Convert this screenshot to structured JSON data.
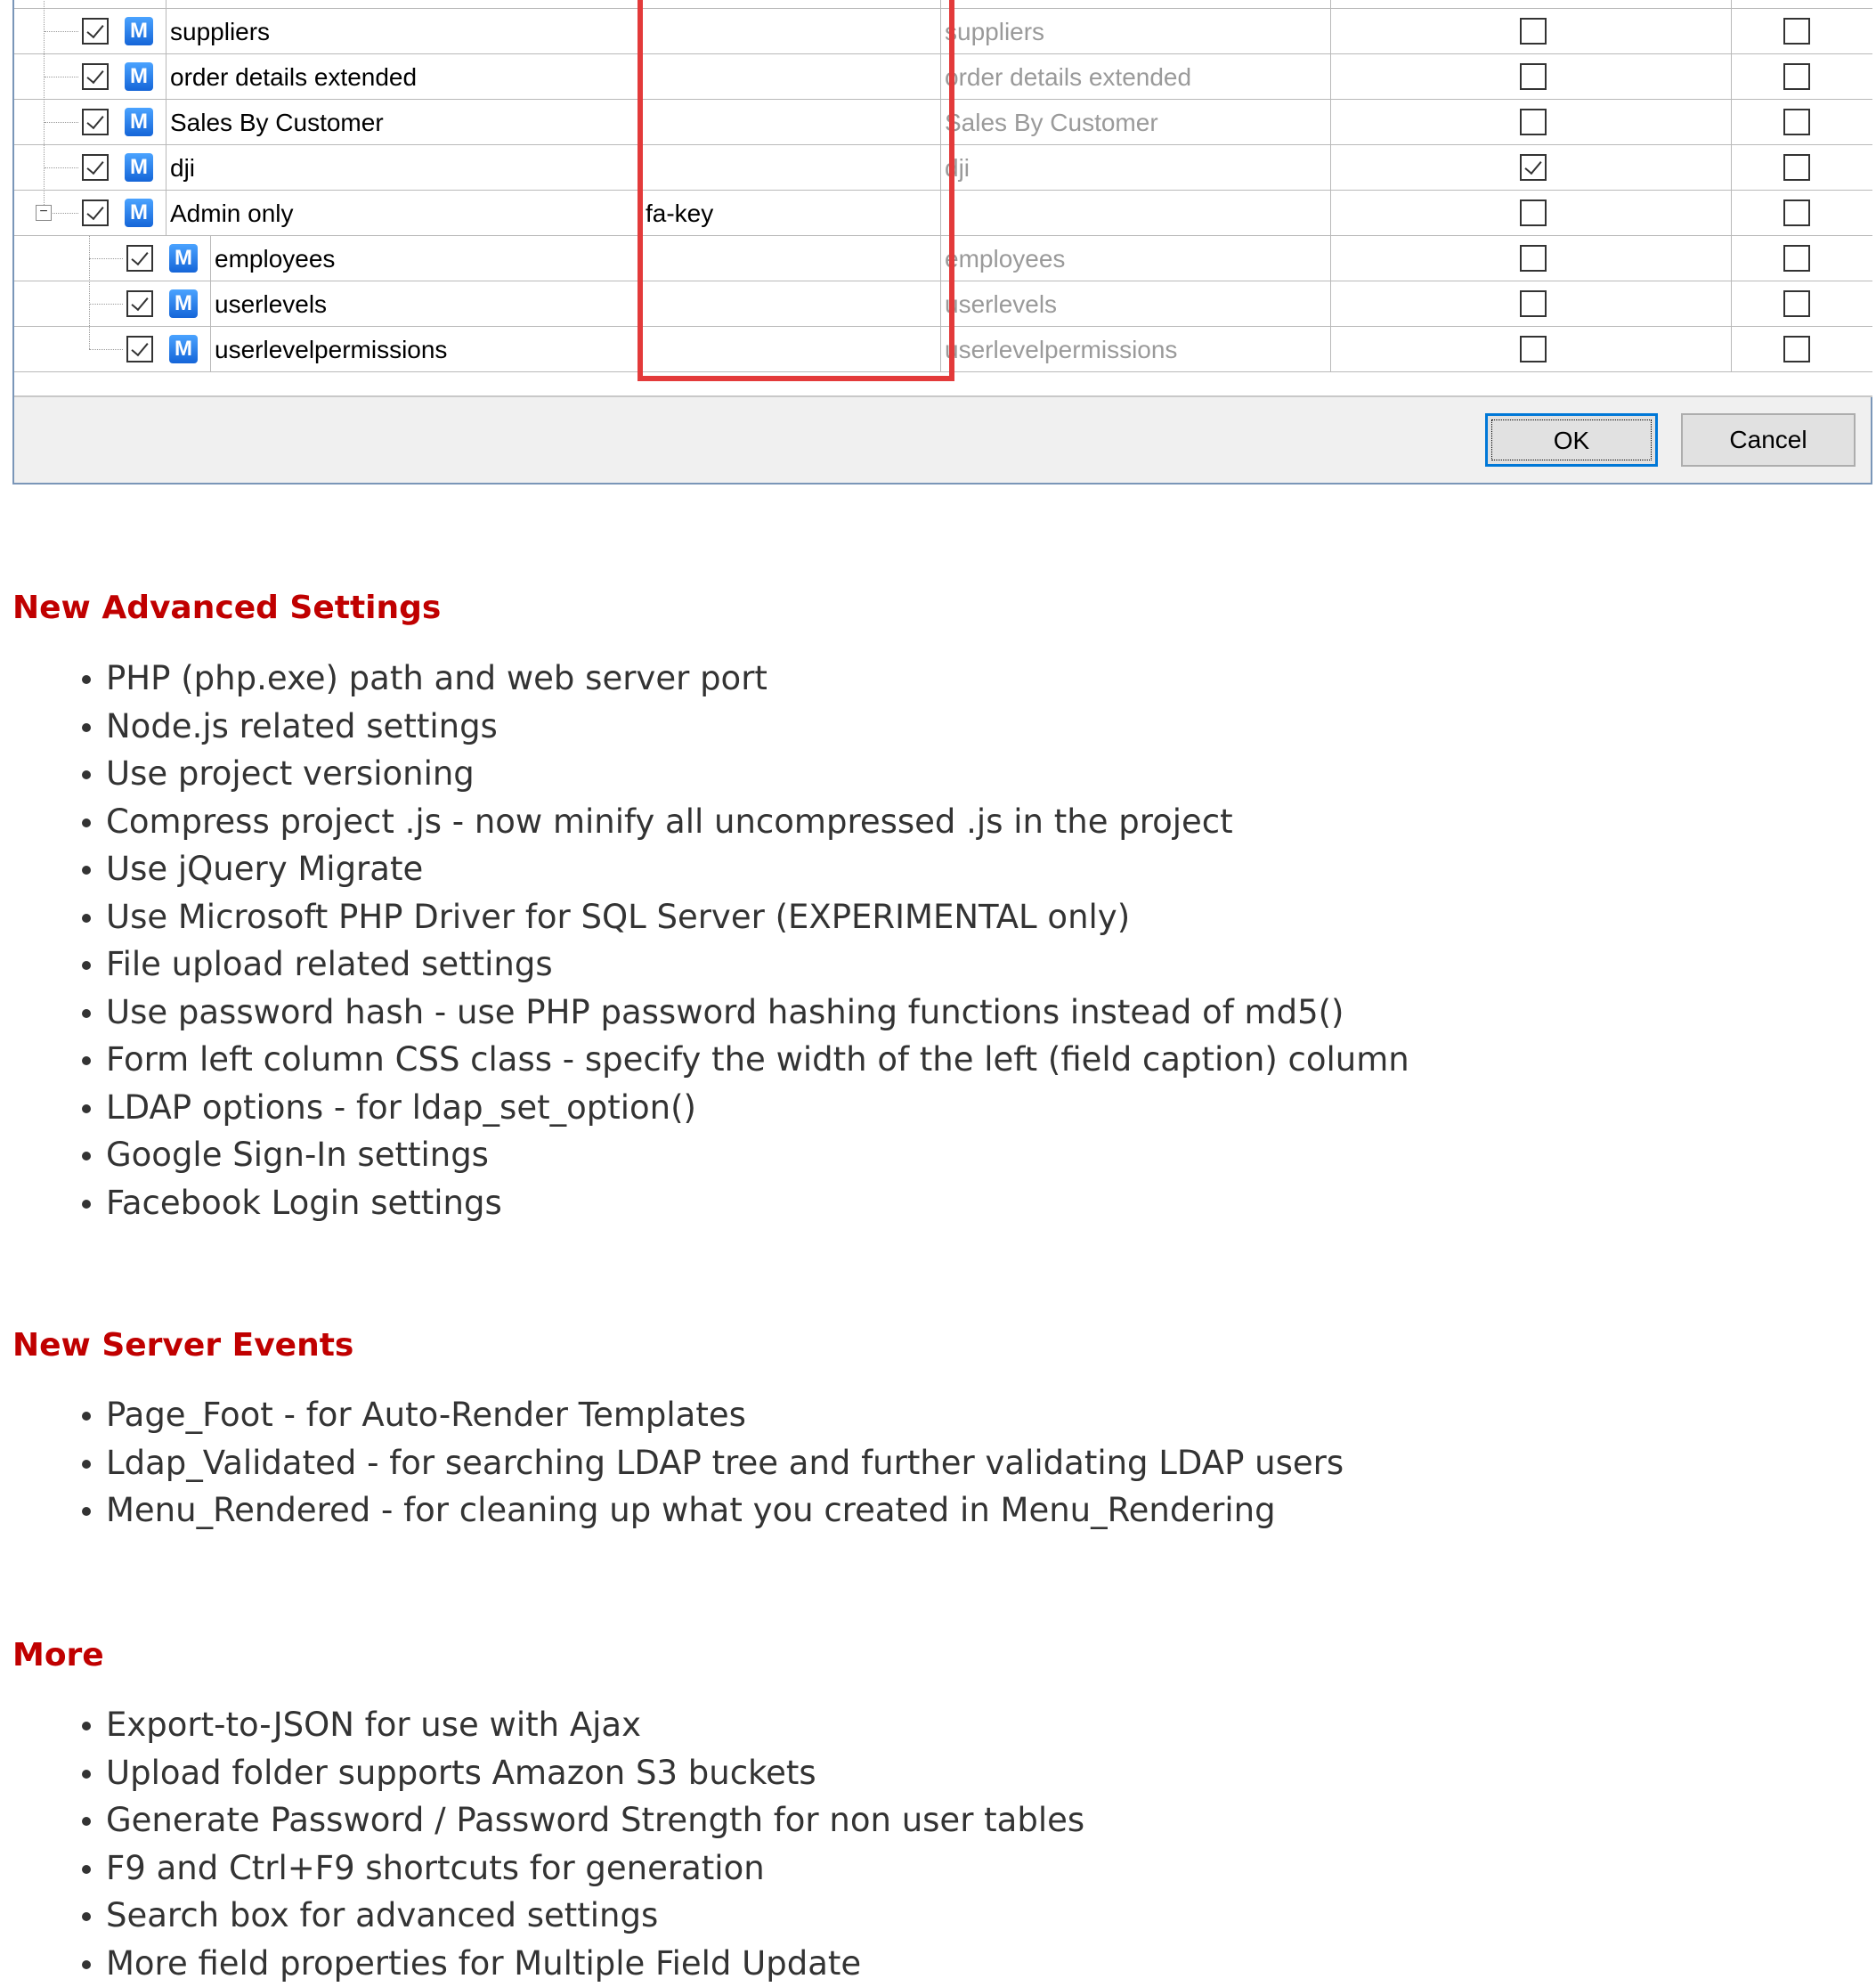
{
  "dialog": {
    "rows": [
      {
        "label": "suppliers",
        "icon_class": "",
        "url": "suppliers",
        "col1": false,
        "col2": false,
        "level": 1
      },
      {
        "label": "order details extended",
        "icon_class": "",
        "url": "order details extended",
        "col1": false,
        "col2": false,
        "level": 1
      },
      {
        "label": "Sales By Customer",
        "icon_class": "",
        "url": "Sales By Customer",
        "col1": false,
        "col2": false,
        "level": 1
      },
      {
        "label": "dji",
        "icon_class": "",
        "url": "dji",
        "col1": true,
        "col2": false,
        "level": 1
      },
      {
        "label": "Admin only",
        "icon_class": "fa-key",
        "url": "",
        "col1": false,
        "col2": false,
        "level": 1,
        "expanded": true
      },
      {
        "label": "employees",
        "icon_class": "",
        "url": "employees",
        "col1": false,
        "col2": false,
        "level": 2
      },
      {
        "label": "userlevels",
        "icon_class": "",
        "url": "userlevels",
        "col1": false,
        "col2": false,
        "level": 2
      },
      {
        "label": "userlevelpermissions",
        "icon_class": "",
        "url": "userlevelpermissions",
        "col1": false,
        "col2": false,
        "level": 2
      }
    ],
    "menu_icon_letter": "M",
    "expander_symbol": "−",
    "ok_label": "OK",
    "cancel_label": "Cancel",
    "highlight_color": "#e33a3a"
  },
  "sections": [
    {
      "title": "New Advanced Settings",
      "items": [
        "PHP (php.exe) path and web server port",
        "Node.js related settings",
        "Use project versioning",
        "Compress project .js - now minify all uncompressed .js in the project",
        "Use jQuery Migrate",
        "Use Microsoft PHP Driver for SQL Server (EXPERIMENTAL only)",
        "File upload related settings",
        "Use password hash - use PHP password hashing functions instead of md5()",
        "Form left column CSS class - specify the width of the left (field caption) column",
        "LDAP options - for ldap_set_option()",
        "Google Sign-In settings",
        "Facebook Login settings"
      ]
    },
    {
      "title": "New Server Events",
      "items": [
        "Page_Foot - for Auto-Render Templates",
        "Ldap_Validated - for searching LDAP tree and further validating LDAP users",
        "Menu_Rendered - for cleaning up what you created in Menu_Rendering"
      ]
    },
    {
      "title": "More",
      "items": [
        "Export-to-JSON for use with Ajax",
        "Upload folder supports Amazon S3 buckets",
        "Generate Password / Password Strength for non user tables",
        "F9 and Ctrl+F9 shortcuts for generation",
        "Search box for advanced settings",
        "More field properties for Multiple Field Update"
      ]
    }
  ],
  "colors": {
    "heading": "#c00000",
    "body_text": "#333333",
    "dialog_bg": "#f0f0f0",
    "ok_border": "#0078d7"
  }
}
